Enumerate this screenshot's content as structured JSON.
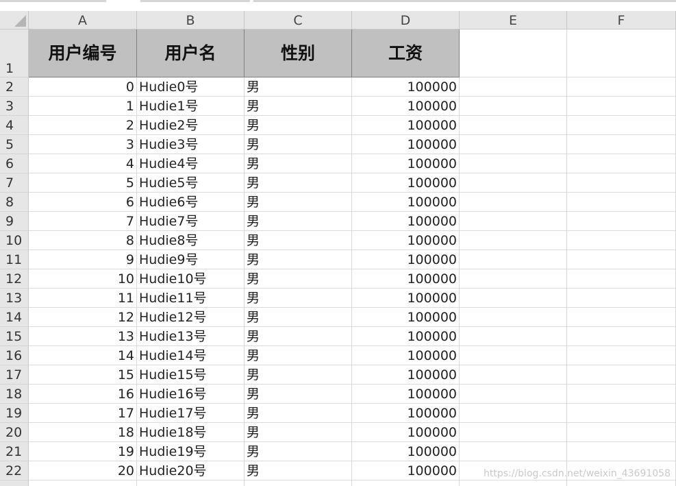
{
  "columns": [
    "A",
    "B",
    "C",
    "D",
    "E",
    "F"
  ],
  "header_row_label": "1",
  "headers": [
    "用户编号",
    "用户名",
    "性别",
    "工资"
  ],
  "rows": [
    {
      "row": "2",
      "id": "0",
      "name": "Hudie0号",
      "gender": "男",
      "salary": "100000"
    },
    {
      "row": "3",
      "id": "1",
      "name": "Hudie1号",
      "gender": "男",
      "salary": "100000"
    },
    {
      "row": "4",
      "id": "2",
      "name": "Hudie2号",
      "gender": "男",
      "salary": "100000"
    },
    {
      "row": "5",
      "id": "3",
      "name": "Hudie3号",
      "gender": "男",
      "salary": "100000"
    },
    {
      "row": "6",
      "id": "4",
      "name": "Hudie4号",
      "gender": "男",
      "salary": "100000"
    },
    {
      "row": "7",
      "id": "5",
      "name": "Hudie5号",
      "gender": "男",
      "salary": "100000"
    },
    {
      "row": "8",
      "id": "6",
      "name": "Hudie6号",
      "gender": "男",
      "salary": "100000"
    },
    {
      "row": "9",
      "id": "7",
      "name": "Hudie7号",
      "gender": "男",
      "salary": "100000"
    },
    {
      "row": "10",
      "id": "8",
      "name": "Hudie8号",
      "gender": "男",
      "salary": "100000"
    },
    {
      "row": "11",
      "id": "9",
      "name": "Hudie9号",
      "gender": "男",
      "salary": "100000"
    },
    {
      "row": "12",
      "id": "10",
      "name": "Hudie10号",
      "gender": "男",
      "salary": "100000"
    },
    {
      "row": "13",
      "id": "11",
      "name": "Hudie11号",
      "gender": "男",
      "salary": "100000"
    },
    {
      "row": "14",
      "id": "12",
      "name": "Hudie12号",
      "gender": "男",
      "salary": "100000"
    },
    {
      "row": "15",
      "id": "13",
      "name": "Hudie13号",
      "gender": "男",
      "salary": "100000"
    },
    {
      "row": "16",
      "id": "14",
      "name": "Hudie14号",
      "gender": "男",
      "salary": "100000"
    },
    {
      "row": "17",
      "id": "15",
      "name": "Hudie15号",
      "gender": "男",
      "salary": "100000"
    },
    {
      "row": "18",
      "id": "16",
      "name": "Hudie16号",
      "gender": "男",
      "salary": "100000"
    },
    {
      "row": "19",
      "id": "17",
      "name": "Hudie17号",
      "gender": "男",
      "salary": "100000"
    },
    {
      "row": "20",
      "id": "18",
      "name": "Hudie18号",
      "gender": "男",
      "salary": "100000"
    },
    {
      "row": "21",
      "id": "19",
      "name": "Hudie19号",
      "gender": "男",
      "salary": "100000"
    },
    {
      "row": "22",
      "id": "20",
      "name": "Hudie20号",
      "gender": "男",
      "salary": "100000"
    }
  ],
  "watermark": "https://blog.csdn.net/weixin_43691058",
  "colors": {
    "header_fill": "#c0c0c0",
    "heading_bar": "#e6e6e6",
    "gridline": "#dadada"
  }
}
